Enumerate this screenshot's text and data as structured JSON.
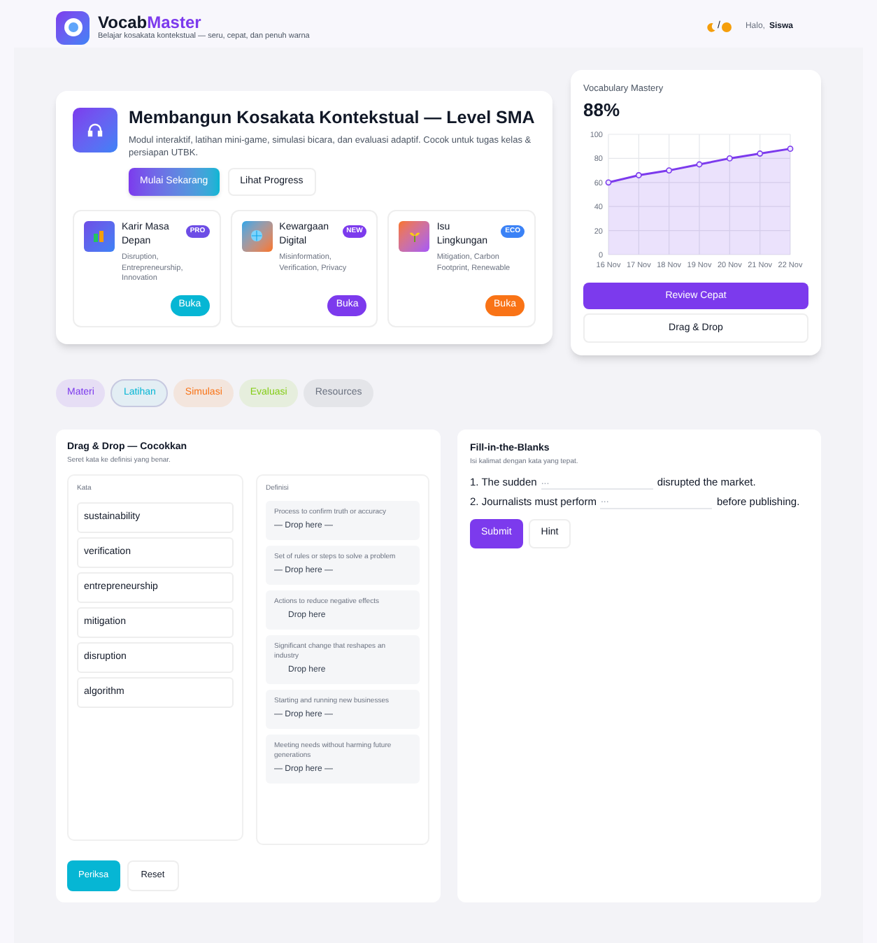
{
  "header": {
    "brand_plain": "Vocab",
    "brand_accent": "Master",
    "tagline": "Belajar kosakata kontekstual — seru, cepat, dan penuh warna",
    "theme_toggle": "/",
    "greeting": "Halo,",
    "user": "Siswa"
  },
  "hero": {
    "title": "Membangun Kosakata Kontekstual — Level SMA",
    "description": "Modul interaktif, latihan mini-game, simulasi bicara, dan evaluasi adaptif. Cocok untuk tugas kelas & persiapan UTBK.",
    "primary_button": "Mulai Sekarang",
    "secondary_button": "Lihat Progress",
    "modules": [
      {
        "title": "Karir Masa Depan",
        "badge": {
          "label": "PRO",
          "color": "#6d4de6"
        },
        "keywords": "Disruption, Entrepreneurship, Innovation",
        "button": "Buka",
        "color": "#06b6d4"
      },
      {
        "title": "Kewargaan Digital",
        "badge": {
          "label": "NEW",
          "color": "#7c3aed"
        },
        "keywords": "Misinformation, Verification, Privacy",
        "button": "Buka",
        "color": "#7c3aed"
      },
      {
        "title": "Isu Lingkungan",
        "badge": {
          "label": "ECO",
          "color": "#3b82f6"
        },
        "keywords": "Mitigation, Carbon Footprint, Renewable",
        "button": "Buka",
        "color": "#f97316"
      }
    ]
  },
  "mastery": {
    "label": "Vocabulary Mastery",
    "value": "88%",
    "chart_data": {
      "type": "area",
      "categories": [
        "16 Nov",
        "17 Nov",
        "18 Nov",
        "19 Nov",
        "20 Nov",
        "21 Nov",
        "22 Nov"
      ],
      "series": [
        {
          "color": "#7c3aed",
          "values": [
            60,
            66,
            70,
            75,
            80,
            84,
            88
          ]
        }
      ],
      "ylim": [
        0,
        100
      ],
      "yticks": [
        0,
        20,
        40,
        60,
        80,
        100
      ],
      "grid": true
    },
    "primary_button": "Review Cepat",
    "secondary_button": "Drag & Drop"
  },
  "tabs": [
    {
      "label": "Materi",
      "selected": false,
      "color": "#7c3aed"
    },
    {
      "label": "Latihan",
      "selected": true,
      "color": "#06b6d4"
    },
    {
      "label": "Simulasi",
      "selected": false,
      "color": "#f97316"
    },
    {
      "label": "Evaluasi",
      "selected": false,
      "color": "#84cc16"
    },
    {
      "label": "Resources",
      "selected": false,
      "color": "#6b7280"
    }
  ],
  "drag_drop": {
    "title": "Drag & Drop — Cocokkan",
    "subtitle": "Seret kata ke definisi yang benar.",
    "words_heading": "Kata",
    "words": [
      "sustainability",
      "verification",
      "entrepreneurship",
      "mitigation",
      "disruption",
      "algorithm"
    ],
    "definitions_heading": "Definisi",
    "definitions": [
      {
        "text": "Process to confirm truth or accuracy",
        "slot": "— Drop here —"
      },
      {
        "text": "Set of rules or steps to solve a problem",
        "slot": "— Drop here —"
      },
      {
        "text": "Actions to reduce negative effects",
        "slot": "Drop here"
      },
      {
        "text": "Significant change that reshapes an industry",
        "slot": "Drop here"
      },
      {
        "text": "Starting and running new businesses",
        "slot": "— Drop here —"
      },
      {
        "text": "Meeting needs without harming future generations",
        "slot": "— Drop here —"
      }
    ],
    "check_button": "Periksa",
    "reset_button": "Reset"
  },
  "fill_blanks": {
    "title": "Fill-in-the-Blanks",
    "subtitle": "Isi kalimat dengan kata yang tepat.",
    "items": [
      {
        "before": "1. The sudden",
        "placeholder": "...",
        "after": "disrupted the market."
      },
      {
        "before": "2. Journalists must perform",
        "placeholder": "...",
        "after": "before publishing."
      }
    ],
    "submit_button": "Submit",
    "hint_button": "Hint"
  }
}
